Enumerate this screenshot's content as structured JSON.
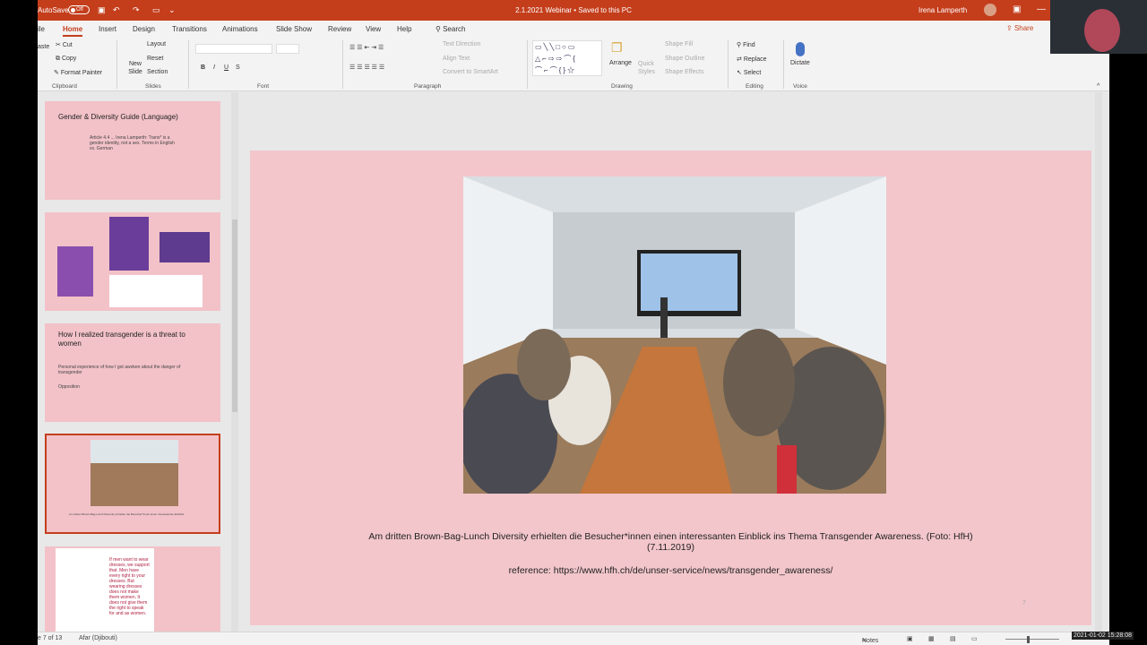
{
  "titlebar": {
    "autosave_label": "AutoSave",
    "autosave_state": "Off",
    "document_title": "2.1.2021 Webinar  •  Saved to this PC",
    "user_name": "Irena Lamperth"
  },
  "tabs": [
    "ile",
    "Home",
    "Insert",
    "Design",
    "Transitions",
    "Animations",
    "Slide Show",
    "Review",
    "View",
    "Help"
  ],
  "active_tab": "Home",
  "search_label": "Search",
  "share_label": "Share",
  "ribbon": {
    "clipboard": {
      "paste": "aste",
      "cut": "Cut",
      "copy": "Copy",
      "format_painter": "Format Painter",
      "label": "Clipboard"
    },
    "slides": {
      "new_slide": "New Slide",
      "layout": "Layout",
      "reset": "Reset",
      "section": "Section",
      "label": "Slides"
    },
    "font": {
      "bold": "B",
      "italic": "I",
      "underline": "U",
      "strike": "S",
      "label": "Font"
    },
    "paragraph": {
      "text_direction": "Text Direction",
      "align_text": "Align Text",
      "convert": "Convert to SmartArt",
      "label": "Paragraph"
    },
    "drawing": {
      "arrange": "Arrange",
      "quick_styles": "Quick Styles",
      "shape_fill": "Shape Fill",
      "shape_outline": "Shape Outline",
      "shape_effects": "Shape Effects",
      "label": "Drawing"
    },
    "editing": {
      "find": "Find",
      "replace": "Replace",
      "select": "Select",
      "label": "Editing"
    },
    "voice": {
      "dictate": "Dictate",
      "label": "Voice"
    }
  },
  "thumbnails": [
    {
      "title": "Gender & Diversity Guide (Language)",
      "body": "Article 4.4 ... Irena Lamperth: Trans* is a gender identity, not a sex. Terms in English vs. German"
    },
    {
      "title": "",
      "body": ""
    },
    {
      "title": "How I realized transgender is a threat to women",
      "bullets": [
        "Personal experience of how I got awoken about the danger of transgender",
        "Opposition"
      ]
    },
    {
      "title": "",
      "body": "Am dritten Brown-Bag-Lunch Diversity erhielten die Besucher*innen einen interessanten Einblick"
    },
    {
      "title": "",
      "body": "If men want to wear dresses, we support that. Men have every right to your dresses. But wearing dresses does not make them women. It does not give them the right to speak for and as women."
    }
  ],
  "slide": {
    "caption_line1": "Am dritten Brown-Bag-Lunch Diversity erhielten die Besucher*innen einen interessanten Einblick ins Thema Transgender Awareness. (Foto: HfH)",
    "caption_line2": "(7.11.2019)",
    "reference": "reference: https://www.hfh.ch/de/unser-service/news/transgender_awareness/",
    "page_number": "7"
  },
  "status": {
    "slide_count": "e 7 of 13",
    "language": "Afar (Djibouti)",
    "notes": "Notes"
  },
  "clock": "2021-01-02  15:28:08",
  "colors": {
    "accent": "#c43e1c",
    "slide_bg": "#f2c6cb"
  }
}
